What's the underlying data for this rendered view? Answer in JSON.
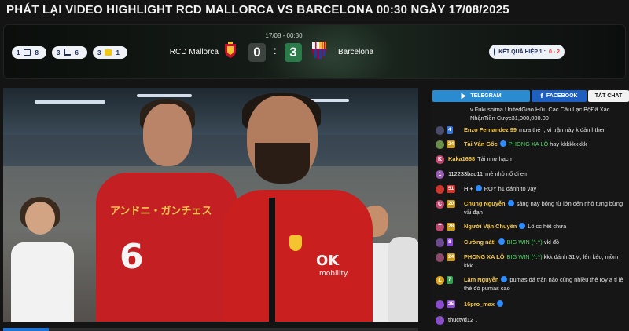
{
  "page": {
    "title": "PHÁT LẠI VIDEO HIGHLIGHT RCD MALLORCA VS BARCELONA 00:30 NGÀY 17/08/2025"
  },
  "match": {
    "datetime": "17/08 - 00:30",
    "home_team": "RCD Mallorca",
    "away_team": "Barcelona",
    "home_score": "0",
    "away_score": "3",
    "separator": ":",
    "stats": [
      {
        "left": "1",
        "icon": "goal-net-icon",
        "right": "8"
      },
      {
        "left": "3",
        "icon": "boot-icon",
        "right": "6"
      },
      {
        "left": "3",
        "icon": "yellow-card-icon",
        "right": "1"
      }
    ],
    "half_result_label": "KẾT QUẢ HIỆP 1 :",
    "half_result_score": "0 - 2"
  },
  "video": {
    "jersey_number": "6",
    "jersey_sponsor": "アンドニ・ガンチェス",
    "sponsor_logo": "OK",
    "sponsor_sub": "mobility",
    "progress": 0.11
  },
  "chat": {
    "tabs": [
      {
        "label": "TELEGRAM",
        "icon": "telegram-icon"
      },
      {
        "label": "FACEBOOK",
        "icon": "facebook-icon"
      },
      {
        "label": "TẤT CHAT",
        "icon": ""
      }
    ],
    "system_message": "v Fukushima UnitedGiao Hữu Các Câu Lạc BộĐã Xác NhậnTiền Cược31,000,000.00",
    "messages": [
      {
        "avatar": "",
        "level": "4",
        "name": "Enzo Fernandez 99",
        "text": "mưa thẻ r, vì trận này k đản hther",
        "nameStyle": "gold",
        "lv": "blue",
        "avColor": "#4a4a6a"
      },
      {
        "avatar": "",
        "level": "24",
        "name": "Tài Vân Gốc",
        "text": "hay kkkkkkkkk",
        "extra": "PHONG XA LÔ",
        "nameStyle": "gold",
        "lv": "gold",
        "avColor": "#6b8f4a",
        "vip": true
      },
      {
        "avatar": "K",
        "level": "",
        "name": "Kaka1668",
        "text": "Tài như hạch",
        "nameStyle": "gold",
        "lv": "",
        "avColor": "#c0476f"
      },
      {
        "avatar": "1",
        "level": "",
        "name": "112233bao11",
        "text": "mẻ nhỏ nổ đi em",
        "nameStyle": "white",
        "lv": "",
        "avColor": "#9b59b6"
      },
      {
        "avatar": "",
        "level": "51",
        "name": "H +",
        "text": "ROY h1 đánh to vậy",
        "nameStyle": "white",
        "lv": "red",
        "avColor": "#d0352d",
        "vip": true
      },
      {
        "avatar": "C",
        "level": "20",
        "name": "Chung Nguyễn",
        "text": "sáng nay bóng từ lớn đến nhỏ tưng bừng vãi đạn",
        "nameStyle": "gold",
        "lv": "gold",
        "avColor": "#c0476f",
        "vip": true
      },
      {
        "avatar": "T",
        "level": "28",
        "name": "Người Vận Chuyển",
        "text": "Lô cc hết chưa",
        "nameStyle": "gold",
        "lv": "gold",
        "avColor": "#c0476f",
        "vip": true
      },
      {
        "avatar": "",
        "level": "8",
        "name": "Cường nát!",
        "text": "vkl đồ",
        "extra": "BIG WIN (^.^)",
        "nameStyle": "gold",
        "lv": "purple",
        "avColor": "#6b4a8f",
        "vip": true
      },
      {
        "avatar": "",
        "level": "24",
        "name": "PHONG XA LÔ",
        "text": "kkk đánh 31M, lên kèo, mồm kkk",
        "extra": "BIG WIN (^.^)",
        "nameStyle": "gold",
        "lv": "gold",
        "avColor": "#8f4a6b"
      },
      {
        "avatar": "L",
        "level": "7",
        "name": "Lâm Nguyễn",
        "text": "pumas đá trận nào cũng nhiều thẻ roy ạ tỉ lệ thẻ đỏ pumas cao",
        "nameStyle": "gold",
        "lv": "green",
        "avColor": "#d8a21e",
        "vip": true
      },
      {
        "avatar": "",
        "level": "25",
        "name": "16pro_max",
        "text": "",
        "nameStyle": "gold",
        "lv": "purple",
        "avColor": "#8b4bd1",
        "vip": true
      },
      {
        "avatar": "T",
        "level": "",
        "name": "thuctvd12",
        "text": ".",
        "nameStyle": "white",
        "lv": "",
        "avColor": "#8b4bd1"
      }
    ]
  },
  "colors": {
    "accent_blue": "#2a8bd0",
    "facebook_blue": "#1f5fbf",
    "away_score_green": "#2a7a4a",
    "name_gold": "#f7c948",
    "text_green": "#4cd964"
  }
}
